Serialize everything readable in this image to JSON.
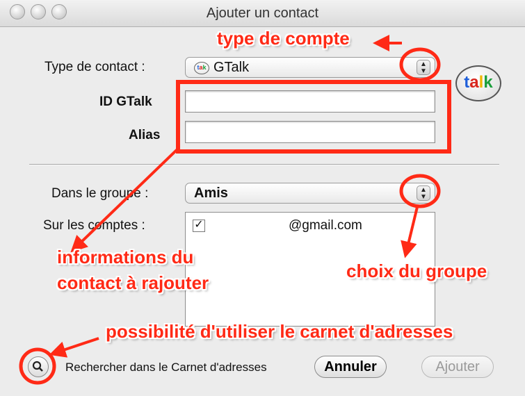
{
  "window": {
    "title": "Ajouter un contact"
  },
  "form": {
    "contact_type_label": "Type de contact :",
    "contact_type_value": "GTalk",
    "id_label": "ID GTalk",
    "id_value": "",
    "alias_label": "Alias",
    "alias_value": "",
    "group_label": "Dans le groupe :",
    "group_value": "Amis",
    "accounts_label": "Sur les comptes :",
    "accounts": [
      {
        "checked": true,
        "label": "@gmail.com"
      }
    ]
  },
  "footer": {
    "search_label": "Rechercher dans le Carnet d'adresses",
    "cancel_label": "Annuler",
    "add_label": "Ajouter"
  },
  "logo": {
    "text": "talk"
  },
  "annotations": {
    "account_type": "type de compte",
    "contact_info_line1": "informations du",
    "contact_info_line2": "contact à rajouter",
    "group_choice": "choix du groupe",
    "address_book": "possibilité d'utiliser le carnet d'adresses"
  },
  "colors": {
    "annotation": "#ff2a16",
    "window_bg": "#ececec"
  },
  "icons": {
    "contact_type": "gtalk-icon",
    "search": "magnifier-icon",
    "popup_arrows": "up-down-arrows-icon"
  }
}
